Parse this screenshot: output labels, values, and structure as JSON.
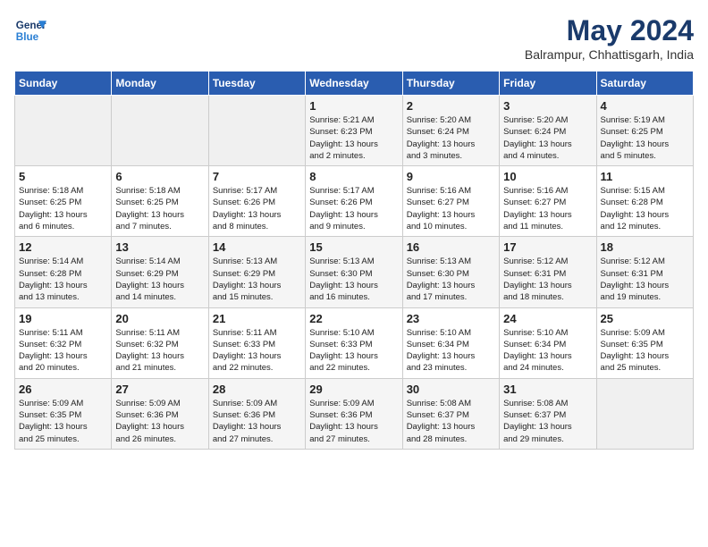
{
  "header": {
    "logo_line1": "General",
    "logo_line2": "Blue",
    "month_year": "May 2024",
    "location": "Balrampur, Chhattisgarh, India"
  },
  "weekdays": [
    "Sunday",
    "Monday",
    "Tuesday",
    "Wednesday",
    "Thursday",
    "Friday",
    "Saturday"
  ],
  "weeks": [
    [
      {
        "day": "",
        "info": ""
      },
      {
        "day": "",
        "info": ""
      },
      {
        "day": "",
        "info": ""
      },
      {
        "day": "1",
        "info": "Sunrise: 5:21 AM\nSunset: 6:23 PM\nDaylight: 13 hours\nand 2 minutes."
      },
      {
        "day": "2",
        "info": "Sunrise: 5:20 AM\nSunset: 6:24 PM\nDaylight: 13 hours\nand 3 minutes."
      },
      {
        "day": "3",
        "info": "Sunrise: 5:20 AM\nSunset: 6:24 PM\nDaylight: 13 hours\nand 4 minutes."
      },
      {
        "day": "4",
        "info": "Sunrise: 5:19 AM\nSunset: 6:25 PM\nDaylight: 13 hours\nand 5 minutes."
      }
    ],
    [
      {
        "day": "5",
        "info": "Sunrise: 5:18 AM\nSunset: 6:25 PM\nDaylight: 13 hours\nand 6 minutes."
      },
      {
        "day": "6",
        "info": "Sunrise: 5:18 AM\nSunset: 6:25 PM\nDaylight: 13 hours\nand 7 minutes."
      },
      {
        "day": "7",
        "info": "Sunrise: 5:17 AM\nSunset: 6:26 PM\nDaylight: 13 hours\nand 8 minutes."
      },
      {
        "day": "8",
        "info": "Sunrise: 5:17 AM\nSunset: 6:26 PM\nDaylight: 13 hours\nand 9 minutes."
      },
      {
        "day": "9",
        "info": "Sunrise: 5:16 AM\nSunset: 6:27 PM\nDaylight: 13 hours\nand 10 minutes."
      },
      {
        "day": "10",
        "info": "Sunrise: 5:16 AM\nSunset: 6:27 PM\nDaylight: 13 hours\nand 11 minutes."
      },
      {
        "day": "11",
        "info": "Sunrise: 5:15 AM\nSunset: 6:28 PM\nDaylight: 13 hours\nand 12 minutes."
      }
    ],
    [
      {
        "day": "12",
        "info": "Sunrise: 5:14 AM\nSunset: 6:28 PM\nDaylight: 13 hours\nand 13 minutes."
      },
      {
        "day": "13",
        "info": "Sunrise: 5:14 AM\nSunset: 6:29 PM\nDaylight: 13 hours\nand 14 minutes."
      },
      {
        "day": "14",
        "info": "Sunrise: 5:13 AM\nSunset: 6:29 PM\nDaylight: 13 hours\nand 15 minutes."
      },
      {
        "day": "15",
        "info": "Sunrise: 5:13 AM\nSunset: 6:30 PM\nDaylight: 13 hours\nand 16 minutes."
      },
      {
        "day": "16",
        "info": "Sunrise: 5:13 AM\nSunset: 6:30 PM\nDaylight: 13 hours\nand 17 minutes."
      },
      {
        "day": "17",
        "info": "Sunrise: 5:12 AM\nSunset: 6:31 PM\nDaylight: 13 hours\nand 18 minutes."
      },
      {
        "day": "18",
        "info": "Sunrise: 5:12 AM\nSunset: 6:31 PM\nDaylight: 13 hours\nand 19 minutes."
      }
    ],
    [
      {
        "day": "19",
        "info": "Sunrise: 5:11 AM\nSunset: 6:32 PM\nDaylight: 13 hours\nand 20 minutes."
      },
      {
        "day": "20",
        "info": "Sunrise: 5:11 AM\nSunset: 6:32 PM\nDaylight: 13 hours\nand 21 minutes."
      },
      {
        "day": "21",
        "info": "Sunrise: 5:11 AM\nSunset: 6:33 PM\nDaylight: 13 hours\nand 22 minutes."
      },
      {
        "day": "22",
        "info": "Sunrise: 5:10 AM\nSunset: 6:33 PM\nDaylight: 13 hours\nand 22 minutes."
      },
      {
        "day": "23",
        "info": "Sunrise: 5:10 AM\nSunset: 6:34 PM\nDaylight: 13 hours\nand 23 minutes."
      },
      {
        "day": "24",
        "info": "Sunrise: 5:10 AM\nSunset: 6:34 PM\nDaylight: 13 hours\nand 24 minutes."
      },
      {
        "day": "25",
        "info": "Sunrise: 5:09 AM\nSunset: 6:35 PM\nDaylight: 13 hours\nand 25 minutes."
      }
    ],
    [
      {
        "day": "26",
        "info": "Sunrise: 5:09 AM\nSunset: 6:35 PM\nDaylight: 13 hours\nand 25 minutes."
      },
      {
        "day": "27",
        "info": "Sunrise: 5:09 AM\nSunset: 6:36 PM\nDaylight: 13 hours\nand 26 minutes."
      },
      {
        "day": "28",
        "info": "Sunrise: 5:09 AM\nSunset: 6:36 PM\nDaylight: 13 hours\nand 27 minutes."
      },
      {
        "day": "29",
        "info": "Sunrise: 5:09 AM\nSunset: 6:36 PM\nDaylight: 13 hours\nand 27 minutes."
      },
      {
        "day": "30",
        "info": "Sunrise: 5:08 AM\nSunset: 6:37 PM\nDaylight: 13 hours\nand 28 minutes."
      },
      {
        "day": "31",
        "info": "Sunrise: 5:08 AM\nSunset: 6:37 PM\nDaylight: 13 hours\nand 29 minutes."
      },
      {
        "day": "",
        "info": ""
      }
    ]
  ]
}
